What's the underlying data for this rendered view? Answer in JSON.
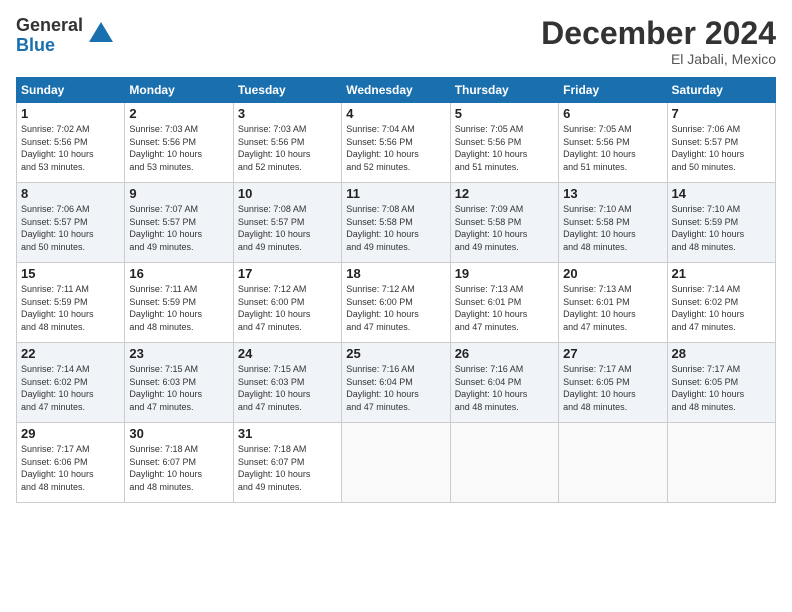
{
  "logo": {
    "general": "General",
    "blue": "Blue"
  },
  "title": "December 2024",
  "location": "El Jabali, Mexico",
  "days_header": [
    "Sunday",
    "Monday",
    "Tuesday",
    "Wednesday",
    "Thursday",
    "Friday",
    "Saturday"
  ],
  "weeks": [
    [
      {
        "day": "1",
        "sunrise": "7:02 AM",
        "sunset": "5:56 PM",
        "daylight": "10 hours and 53 minutes."
      },
      {
        "day": "2",
        "sunrise": "7:03 AM",
        "sunset": "5:56 PM",
        "daylight": "10 hours and 53 minutes."
      },
      {
        "day": "3",
        "sunrise": "7:03 AM",
        "sunset": "5:56 PM",
        "daylight": "10 hours and 52 minutes."
      },
      {
        "day": "4",
        "sunrise": "7:04 AM",
        "sunset": "5:56 PM",
        "daylight": "10 hours and 52 minutes."
      },
      {
        "day": "5",
        "sunrise": "7:05 AM",
        "sunset": "5:56 PM",
        "daylight": "10 hours and 51 minutes."
      },
      {
        "day": "6",
        "sunrise": "7:05 AM",
        "sunset": "5:56 PM",
        "daylight": "10 hours and 51 minutes."
      },
      {
        "day": "7",
        "sunrise": "7:06 AM",
        "sunset": "5:57 PM",
        "daylight": "10 hours and 50 minutes."
      }
    ],
    [
      {
        "day": "8",
        "sunrise": "7:06 AM",
        "sunset": "5:57 PM",
        "daylight": "10 hours and 50 minutes."
      },
      {
        "day": "9",
        "sunrise": "7:07 AM",
        "sunset": "5:57 PM",
        "daylight": "10 hours and 49 minutes."
      },
      {
        "day": "10",
        "sunrise": "7:08 AM",
        "sunset": "5:57 PM",
        "daylight": "10 hours and 49 minutes."
      },
      {
        "day": "11",
        "sunrise": "7:08 AM",
        "sunset": "5:58 PM",
        "daylight": "10 hours and 49 minutes."
      },
      {
        "day": "12",
        "sunrise": "7:09 AM",
        "sunset": "5:58 PM",
        "daylight": "10 hours and 49 minutes."
      },
      {
        "day": "13",
        "sunrise": "7:10 AM",
        "sunset": "5:58 PM",
        "daylight": "10 hours and 48 minutes."
      },
      {
        "day": "14",
        "sunrise": "7:10 AM",
        "sunset": "5:59 PM",
        "daylight": "10 hours and 48 minutes."
      }
    ],
    [
      {
        "day": "15",
        "sunrise": "7:11 AM",
        "sunset": "5:59 PM",
        "daylight": "10 hours and 48 minutes."
      },
      {
        "day": "16",
        "sunrise": "7:11 AM",
        "sunset": "5:59 PM",
        "daylight": "10 hours and 48 minutes."
      },
      {
        "day": "17",
        "sunrise": "7:12 AM",
        "sunset": "6:00 PM",
        "daylight": "10 hours and 47 minutes."
      },
      {
        "day": "18",
        "sunrise": "7:12 AM",
        "sunset": "6:00 PM",
        "daylight": "10 hours and 47 minutes."
      },
      {
        "day": "19",
        "sunrise": "7:13 AM",
        "sunset": "6:01 PM",
        "daylight": "10 hours and 47 minutes."
      },
      {
        "day": "20",
        "sunrise": "7:13 AM",
        "sunset": "6:01 PM",
        "daylight": "10 hours and 47 minutes."
      },
      {
        "day": "21",
        "sunrise": "7:14 AM",
        "sunset": "6:02 PM",
        "daylight": "10 hours and 47 minutes."
      }
    ],
    [
      {
        "day": "22",
        "sunrise": "7:14 AM",
        "sunset": "6:02 PM",
        "daylight": "10 hours and 47 minutes."
      },
      {
        "day": "23",
        "sunrise": "7:15 AM",
        "sunset": "6:03 PM",
        "daylight": "10 hours and 47 minutes."
      },
      {
        "day": "24",
        "sunrise": "7:15 AM",
        "sunset": "6:03 PM",
        "daylight": "10 hours and 47 minutes."
      },
      {
        "day": "25",
        "sunrise": "7:16 AM",
        "sunset": "6:04 PM",
        "daylight": "10 hours and 47 minutes."
      },
      {
        "day": "26",
        "sunrise": "7:16 AM",
        "sunset": "6:04 PM",
        "daylight": "10 hours and 48 minutes."
      },
      {
        "day": "27",
        "sunrise": "7:17 AM",
        "sunset": "6:05 PM",
        "daylight": "10 hours and 48 minutes."
      },
      {
        "day": "28",
        "sunrise": "7:17 AM",
        "sunset": "6:05 PM",
        "daylight": "10 hours and 48 minutes."
      }
    ],
    [
      {
        "day": "29",
        "sunrise": "7:17 AM",
        "sunset": "6:06 PM",
        "daylight": "10 hours and 48 minutes."
      },
      {
        "day": "30",
        "sunrise": "7:18 AM",
        "sunset": "6:07 PM",
        "daylight": "10 hours and 48 minutes."
      },
      {
        "day": "31",
        "sunrise": "7:18 AM",
        "sunset": "6:07 PM",
        "daylight": "10 hours and 49 minutes."
      },
      null,
      null,
      null,
      null
    ]
  ],
  "labels": {
    "sunrise": "Sunrise:",
    "sunset": "Sunset:",
    "daylight": "Daylight:"
  }
}
